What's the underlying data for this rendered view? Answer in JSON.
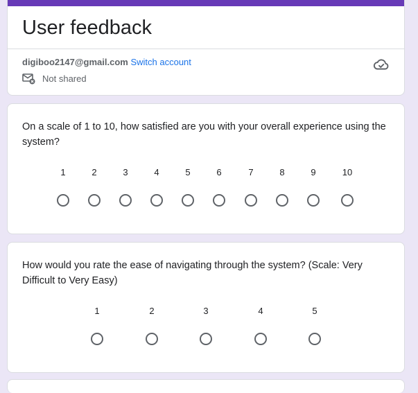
{
  "header": {
    "title": "User feedback",
    "email": "digiboo2147@gmail.com",
    "switch_account": "Switch account",
    "sharing_status": "Not shared"
  },
  "questions": [
    {
      "text": "On a scale of 1 to 10, how satisfied are you with your overall experience using the system?",
      "options": [
        "1",
        "2",
        "3",
        "4",
        "5",
        "6",
        "7",
        "8",
        "9",
        "10"
      ]
    },
    {
      "text": "How would you rate the ease of navigating through the system? (Scale: Very Difficult to Very Easy)",
      "options": [
        "1",
        "2",
        "3",
        "4",
        "5"
      ]
    }
  ],
  "colors": {
    "accent": "#673ab7",
    "link": "#1a73e8",
    "background": "#ebe6f6"
  }
}
